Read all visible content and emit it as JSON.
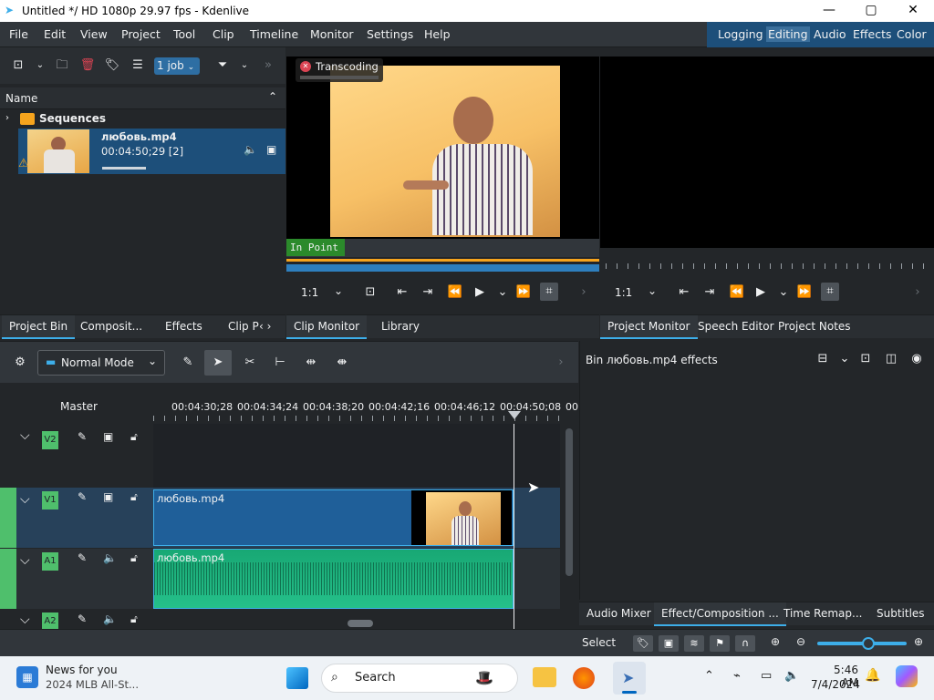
{
  "window": {
    "title": "Untitled */ HD 1080p 29.97 fps - Kdenlive",
    "minimize": "—",
    "maximize": "▢",
    "close": "✕"
  },
  "menu": [
    "File",
    "Edit",
    "View",
    "Project",
    "Tool",
    "Clip",
    "Timeline",
    "Monitor",
    "Settings",
    "Help"
  ],
  "layouts": [
    "Logging",
    "Editing",
    "Audio",
    "Effects",
    "Color"
  ],
  "layouts_selected": "Editing",
  "bin": {
    "jobs_label": "1 job",
    "column_header": "Name",
    "folder": "Sequences",
    "clip_name": "любовь.mp4",
    "clip_duration": "00:04:50;29 [2]",
    "tabs": [
      "Project Bin",
      "Composit...",
      "Effects",
      "Clip P"
    ]
  },
  "clip_monitor": {
    "transcoding": "Transcoding",
    "in_point": "In Point",
    "zoom": "1:1",
    "tabs": [
      "Clip Monitor",
      "Library"
    ]
  },
  "project_monitor": {
    "zoom": "1:1",
    "tabs": [
      "Project Monitor",
      "Speech Editor",
      "Project Notes"
    ]
  },
  "timeline": {
    "mode": "Normal Mode",
    "master": "Master",
    "timecodes": [
      "00:04:30;28",
      "00:04:34;24",
      "00:04:38;20",
      "00:04:42;16",
      "00:04:46;12",
      "00:04:50;08",
      "00:"
    ],
    "tracks": [
      {
        "name": "V2",
        "type": "video"
      },
      {
        "name": "V1",
        "type": "video"
      },
      {
        "name": "A1",
        "type": "audio"
      },
      {
        "name": "A2",
        "type": "audio"
      }
    ],
    "v1_clip": "любовь.mp4",
    "a1_clip": "любовь.mp4"
  },
  "effects_panel": {
    "title": "Bin любовь.mp4 effects",
    "tabs": [
      "Audio Mixer",
      "Effect/Composition ...",
      "Time Remap...",
      "Subtitles"
    ]
  },
  "status": {
    "select_label": "Select"
  },
  "taskbar": {
    "news_title": "News for you",
    "news_sub": "2024 MLB All-St...",
    "search": "Search",
    "time": "5:46 AM",
    "date": "7/4/2024"
  },
  "colors": {
    "accent": "#3daee9",
    "clip_blue": "#1f5f99",
    "audio_green": "#25c08a",
    "track_green": "#4fbf6c"
  }
}
